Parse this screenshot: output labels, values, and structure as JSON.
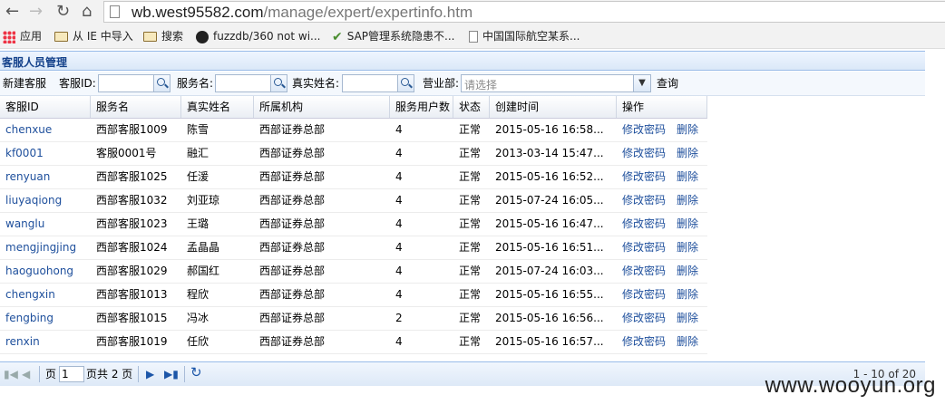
{
  "browser": {
    "url_host": "wb.west95582.com",
    "url_path": "/manage/expert/expertinfo.htm",
    "bookmarks": [
      "应用",
      "从 IE 中导入",
      "搜索",
      "fuzzdb/360 not wi...",
      "SAP管理系统隐患不...",
      "中国国际航空某系..."
    ]
  },
  "panel": {
    "title": "客服人员管理"
  },
  "toolbar": {
    "new_button": "新建客服",
    "id_label": "客服ID:",
    "service_name_label": "服务名:",
    "real_name_label": "真实姓名:",
    "department_label": "营业部:",
    "department_placeholder": "请选择",
    "query_button": "查询"
  },
  "grid": {
    "columns": [
      "客服ID",
      "服务名",
      "真实姓名",
      "所属机构",
      "服务用户数",
      "状态",
      "创建时间",
      "操作"
    ],
    "rows": [
      {
        "id": "chenxue",
        "service": "西部客服1009",
        "real_name": "陈雪",
        "org": "西部证券总部",
        "users": "4",
        "status": "正常",
        "created": "2015-05-16 16:58..."
      },
      {
        "id": "kf0001",
        "service": "客服0001号",
        "real_name": "融汇",
        "org": "西部证券总部",
        "users": "4",
        "status": "正常",
        "created": "2013-03-14 15:47..."
      },
      {
        "id": "renyuan",
        "service": "西部客服1025",
        "real_name": "任湲",
        "org": "西部证券总部",
        "users": "4",
        "status": "正常",
        "created": "2015-05-16 16:52..."
      },
      {
        "id": "liuyaqiong",
        "service": "西部客服1032",
        "real_name": "刘亚琼",
        "org": "西部证券总部",
        "users": "4",
        "status": "正常",
        "created": "2015-07-24 16:05..."
      },
      {
        "id": "wanglu",
        "service": "西部客服1023",
        "real_name": "王璐",
        "org": "西部证券总部",
        "users": "4",
        "status": "正常",
        "created": "2015-05-16 16:47..."
      },
      {
        "id": "mengjingjing",
        "service": "西部客服1024",
        "real_name": "孟晶晶",
        "org": "西部证券总部",
        "users": "4",
        "status": "正常",
        "created": "2015-05-16 16:51..."
      },
      {
        "id": "haoguohong",
        "service": "西部客服1029",
        "real_name": "郝国红",
        "org": "西部证券总部",
        "users": "4",
        "status": "正常",
        "created": "2015-07-24 16:03..."
      },
      {
        "id": "chengxin",
        "service": "西部客服1013",
        "real_name": "程欣",
        "org": "西部证券总部",
        "users": "4",
        "status": "正常",
        "created": "2015-05-16 16:55..."
      },
      {
        "id": "fengbing",
        "service": "西部客服1015",
        "real_name": "冯冰",
        "org": "西部证券总部",
        "users": "2",
        "status": "正常",
        "created": "2015-05-16 16:56..."
      },
      {
        "id": "renxin",
        "service": "西部客服1019",
        "real_name": "任欣",
        "org": "西部证券总部",
        "users": "4",
        "status": "正常",
        "created": "2015-05-16 16:57..."
      }
    ],
    "action_change_password": "修改密码",
    "action_delete": "删除"
  },
  "pager": {
    "page_label": "页",
    "page_value": "1",
    "total_label": "页共 2 页",
    "summary": "1 - 10 of 20"
  },
  "watermark": "www.wooyun.org"
}
